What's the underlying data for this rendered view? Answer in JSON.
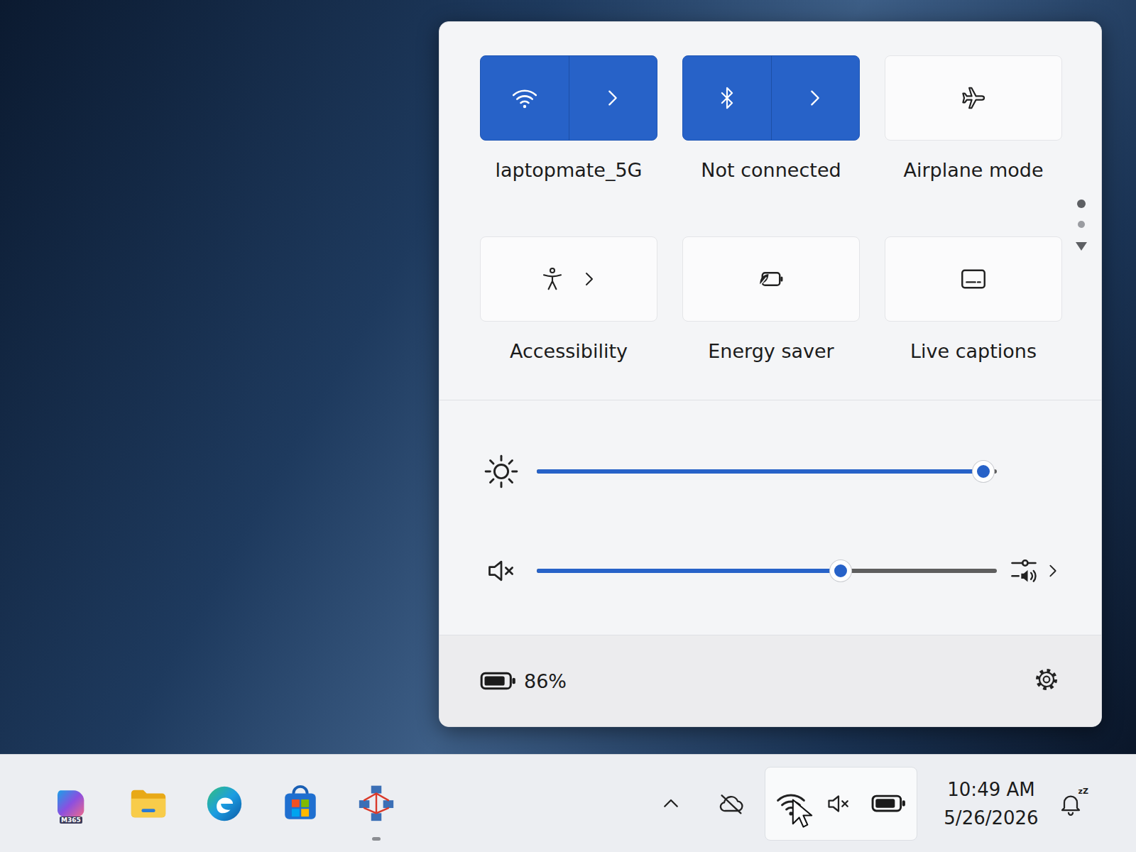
{
  "quick_settings": {
    "tiles": [
      {
        "label": "laptopmate_5G",
        "on": true,
        "kind": "split"
      },
      {
        "label": "Not connected",
        "on": true,
        "kind": "split"
      },
      {
        "label": "Airplane mode",
        "on": false,
        "kind": "toggle"
      },
      {
        "label": "Accessibility",
        "on": false,
        "kind": "expand"
      },
      {
        "label": "Energy saver",
        "on": false,
        "kind": "toggle"
      },
      {
        "label": "Live captions",
        "on": false,
        "kind": "toggle"
      }
    ],
    "pages": [
      {
        "selected": true
      },
      {
        "selected": false
      }
    ],
    "sliders": [
      {
        "kind": "brightness",
        "level": 0.97,
        "muted": false
      },
      {
        "kind": "volume",
        "level": 0.66,
        "muted": true
      }
    ],
    "battery": {
      "percent": "86%",
      "level": 0.86
    }
  },
  "taskbar": {
    "apps": [
      {
        "badge": "M365",
        "running": false
      },
      {
        "running": false
      },
      {
        "running": false
      },
      {
        "running": false
      },
      {
        "running": true
      }
    ],
    "tray": {
      "active": true,
      "muted": true,
      "battery_level": 0.86
    },
    "clock": {
      "time": "10:49 AM",
      "date": "5/26/2026"
    },
    "notifications": {
      "badge": "zZ"
    }
  }
}
